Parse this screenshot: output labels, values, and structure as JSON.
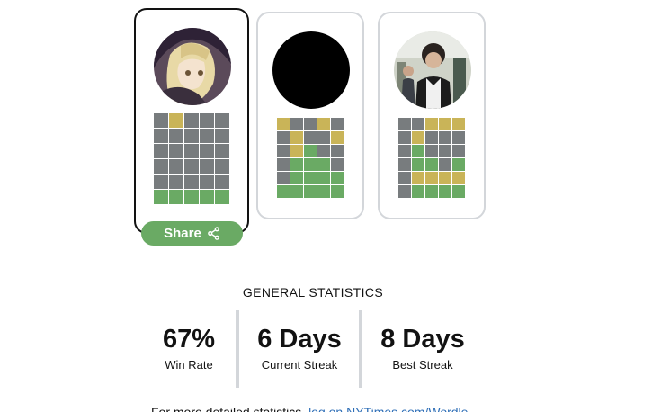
{
  "colors": {
    "green": "#6aaa64",
    "yellow": "#c9b458",
    "gray": "#787c7e",
    "border": "#d3d6da"
  },
  "players": [
    {
      "avatar": "anime-girl-avatar",
      "selected": true,
      "rows": [
        "gyggg",
        "ggggg",
        "ggggg",
        "ggggg",
        "ggggg",
        "GGGGG"
      ]
    },
    {
      "avatar": "black-circle-avatar",
      "selected": false,
      "rows": [
        "yggyg",
        "gyggy",
        "gyGgg",
        "gGGGg",
        "gGGGG",
        "GGGGG"
      ]
    },
    {
      "avatar": "photo-avatar",
      "selected": false,
      "rows": [
        "ggyyy",
        "gyggg",
        "gGggg",
        "gGGgG",
        "gyyyy",
        "gGGGG"
      ]
    }
  ],
  "share_label": "Share",
  "stats": {
    "title": "GENERAL STATISTICS",
    "items": [
      {
        "value": "67%",
        "label": "Win Rate"
      },
      {
        "value": "6 Days",
        "label": "Current Streak"
      },
      {
        "value": "8 Days",
        "label": "Best Streak"
      }
    ]
  },
  "footer": {
    "prefix": "For more detailed statistics, ",
    "link": "log on NYTimes.com/Wordle"
  }
}
